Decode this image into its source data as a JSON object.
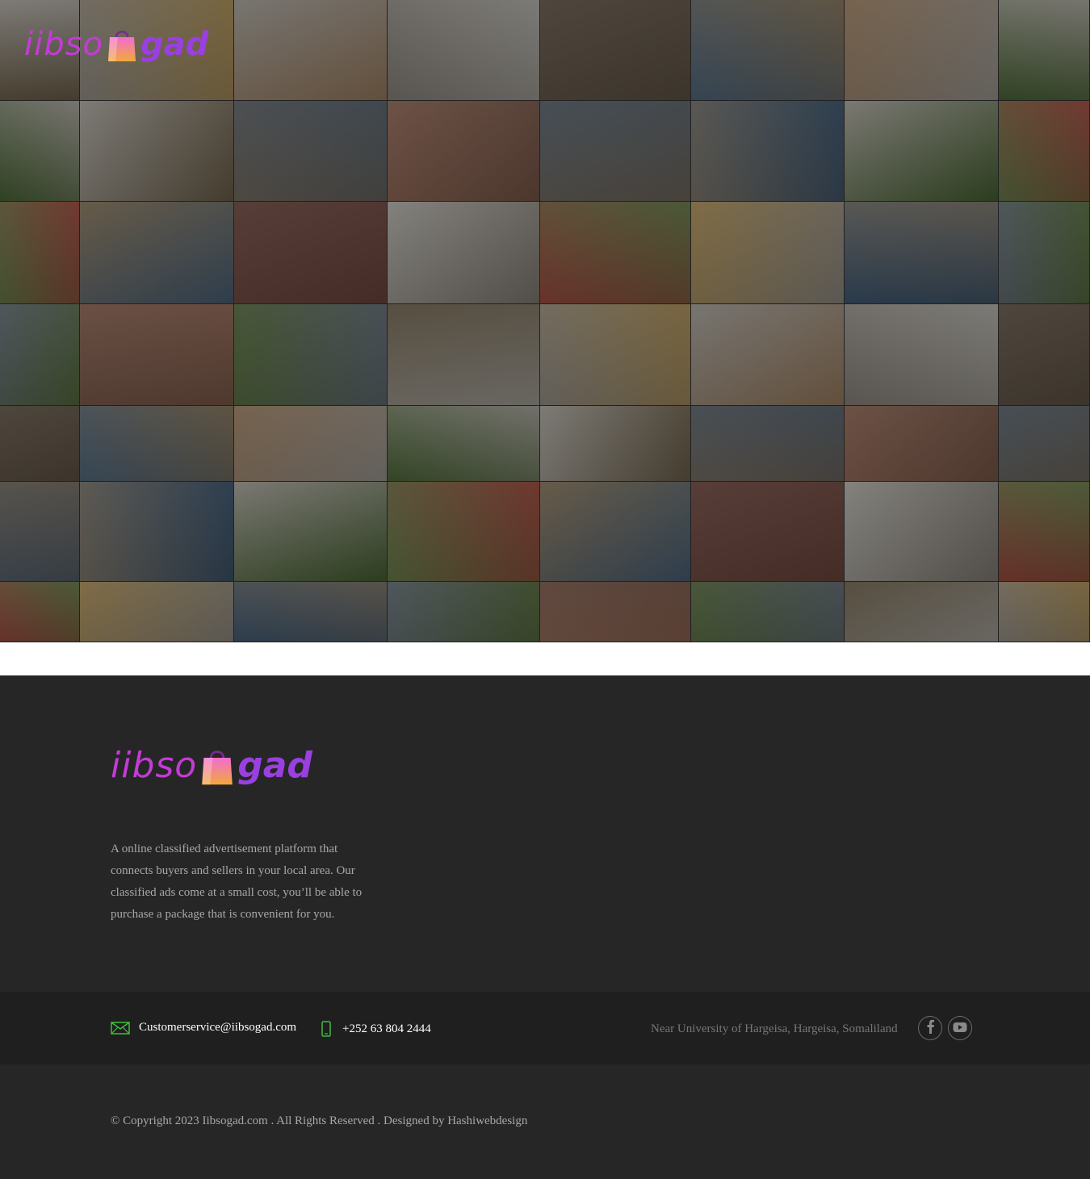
{
  "brand": {
    "logo_part1": "iibso",
    "logo_part2": "gad",
    "colors": {
      "pink": "#c43bd6",
      "purple": "#9a3fe0",
      "bag_top": "#f26cd1",
      "bag_bottom": "#f2a93b"
    }
  },
  "hero": {
    "icon": "classified-items-photo-mosaic"
  },
  "footer": {
    "description": "A online classified advertisement platform that connects buyers and sellers in your local area. Our classified ads come at a small cost, you’ll be able to purchase a package that is convenient for you.",
    "email": "Customerservice@iibsogad.com",
    "phone": "+252 63 804 2444",
    "address": "Near University of Hargeisa, Hargeisa, Somaliland",
    "social": [
      {
        "icon": "facebook-icon"
      },
      {
        "icon": "youtube-icon"
      }
    ],
    "copyright": "© Copyright 2023 Iibsogad.com . All Rights Reserved . Designed by Hashiwebdesign",
    "colors": {
      "background": "#262626",
      "bar": "#1f1f1f",
      "accent_green": "#3fbf3f"
    }
  }
}
